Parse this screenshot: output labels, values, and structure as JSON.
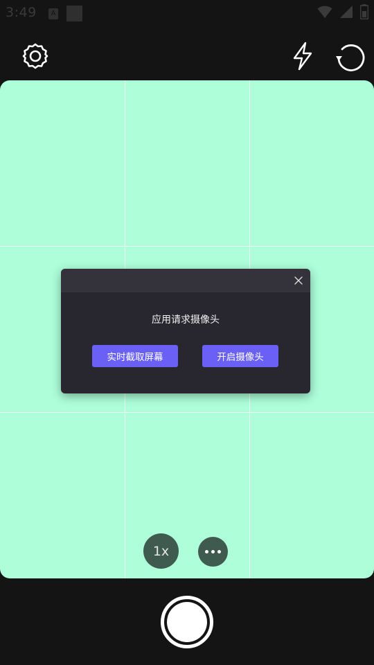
{
  "status_bar": {
    "time": "3:49",
    "icons": [
      "notification-a-icon",
      "notification-square-icon",
      "wifi-icon",
      "signal-icon",
      "battery-icon"
    ]
  },
  "top_bar": {
    "icons": [
      "settings-icon",
      "flash-icon",
      "rotate-camera-icon"
    ]
  },
  "viewfinder": {
    "background_color": "#adfed9",
    "grid": "3x3"
  },
  "dialog": {
    "message": "应用请求摄像头",
    "buttons": {
      "screen_capture": "实时截取屏幕",
      "open_camera": "开启摄像头"
    },
    "accent_color": "#6a60f5"
  },
  "controls": {
    "zoom_label": "1x",
    "more_icon": "more-dots-icon",
    "shutter_icon": "shutter-icon"
  }
}
